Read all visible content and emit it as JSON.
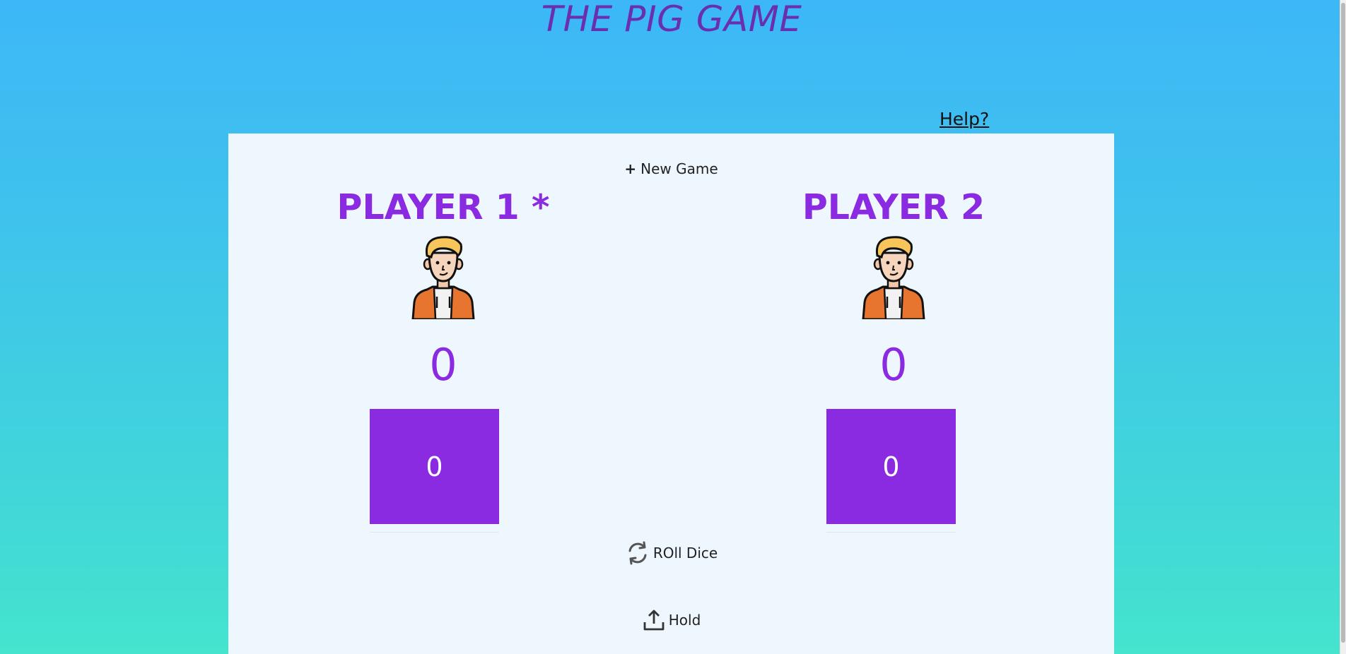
{
  "header": {
    "title": "THE PIG GAME",
    "help_label": "Help?"
  },
  "controls": {
    "new_game_label": "New Game",
    "roll_label": "ROll Dice",
    "hold_label": "Hold"
  },
  "players": [
    {
      "name": "PLAYER 1 *",
      "score": "0",
      "current": "0",
      "active": true
    },
    {
      "name": "PLAYER 2",
      "score": "0",
      "current": "0",
      "active": false
    }
  ],
  "icons": {
    "avatar": "person-avatar-icon",
    "roll": "refresh-icon",
    "hold": "upload-icon"
  },
  "colors": {
    "accent": "#8a2be2",
    "title": "#6a2fb0",
    "board": "#eef7fd"
  }
}
